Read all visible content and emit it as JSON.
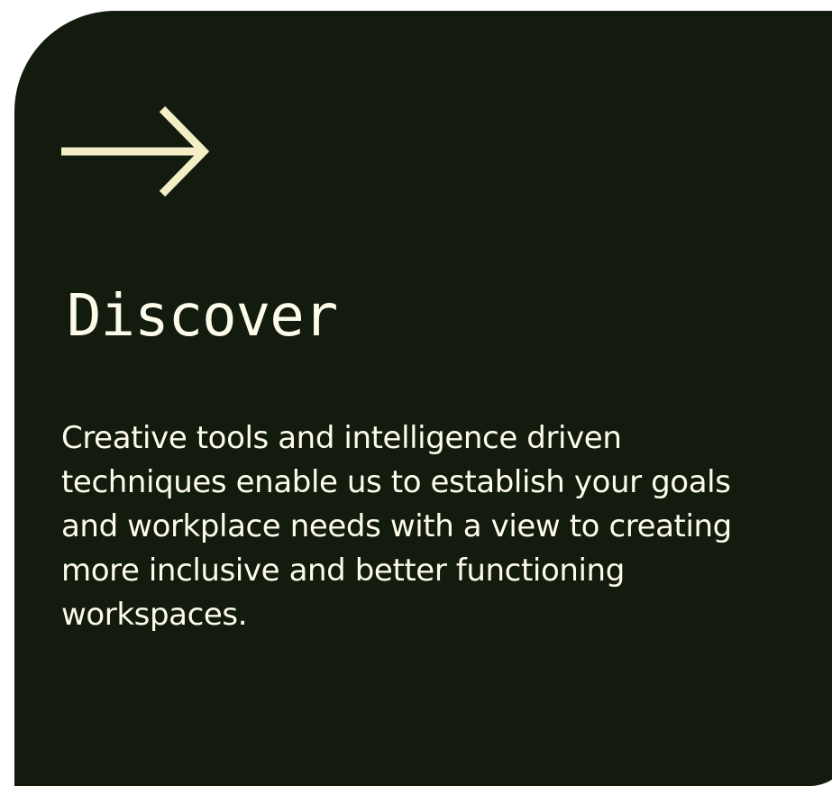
{
  "card": {
    "icon": "arrow-right-icon",
    "title": "Discover",
    "description": "Creative tools and intelligence driven techniques enable us to establish your goals and workplace needs with a view to creating more inclusive and better functioning workspaces."
  },
  "colors": {
    "background": "#121b0e",
    "text": "#fdfbe9",
    "accent": "#f4eec6"
  }
}
